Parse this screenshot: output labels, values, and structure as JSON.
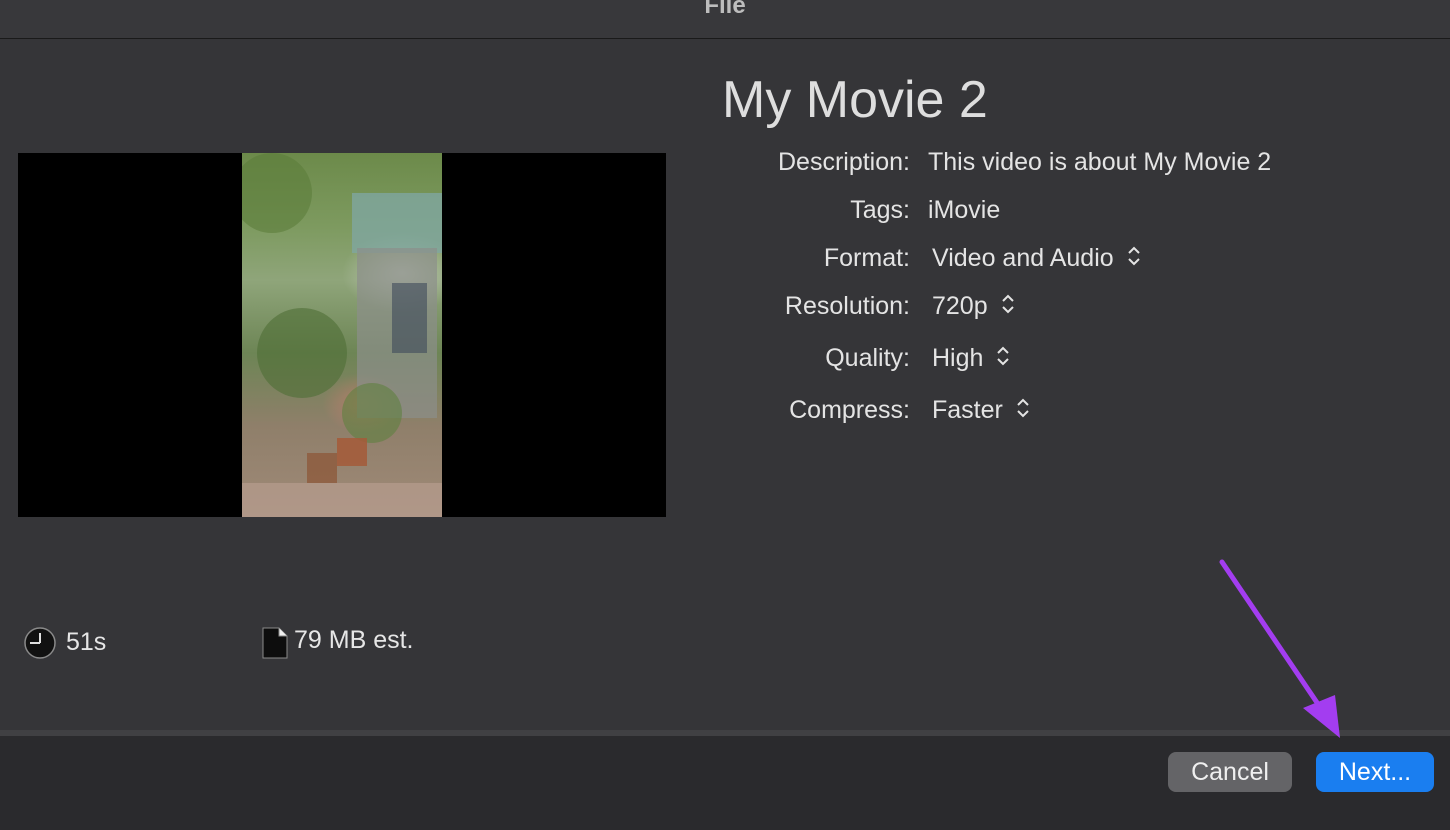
{
  "window": {
    "title": "File"
  },
  "movie": {
    "title": "My Movie 2"
  },
  "fields": {
    "description": {
      "label": "Description:",
      "value": "This video is about My Movie 2"
    },
    "tags": {
      "label": "Tags:",
      "value": "iMovie"
    },
    "format": {
      "label": "Format:",
      "value": "Video and Audio"
    },
    "resolution": {
      "label": "Resolution:",
      "value": "720p"
    },
    "quality": {
      "label": "Quality:",
      "value": "High"
    },
    "compress": {
      "label": "Compress:",
      "value": "Faster"
    }
  },
  "stats": {
    "duration": "51s",
    "size": "79 MB est."
  },
  "buttons": {
    "cancel": "Cancel",
    "next": "Next..."
  },
  "colors": {
    "accent": "#1a7ef0",
    "annotation_arrow": "#a33df0"
  }
}
